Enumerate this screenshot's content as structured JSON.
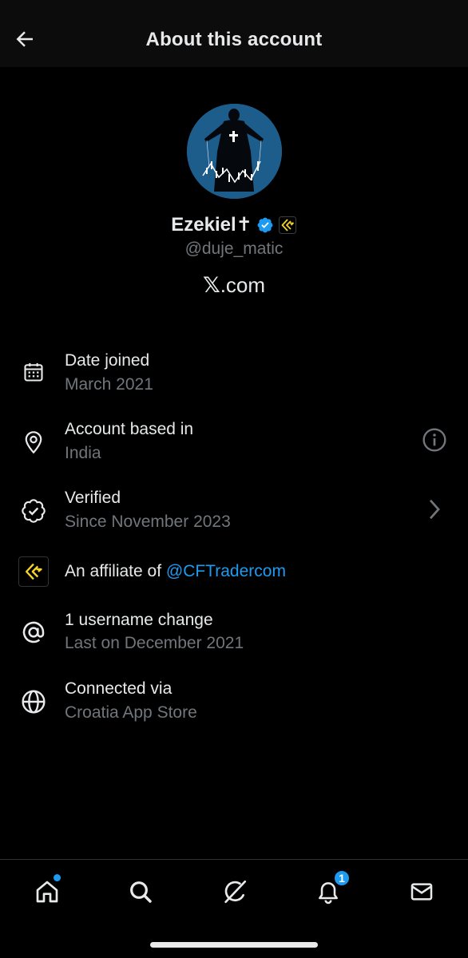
{
  "header": {
    "back_icon": "arrow-left-icon",
    "title": "About this account"
  },
  "profile": {
    "avatar_icon": "profile-avatar",
    "display_name": "Ezekiel✝",
    "verified_icon": "verified-badge-icon",
    "affiliate_badge_icon": "cftrader-affiliate-badge-icon",
    "handle": "@duje_matic",
    "x_letter": "𝕏",
    "domain_suffix": ".com"
  },
  "details": [
    {
      "icon": "calendar-icon",
      "title": "Date joined",
      "subtitle": "March 2021"
    },
    {
      "icon": "location-pin-icon",
      "title": "Account based in",
      "subtitle": "India",
      "right_icon": "info-icon"
    },
    {
      "icon": "verified-check-icon",
      "title": "Verified",
      "subtitle": "Since November 2023",
      "right_icon": "chevron-right-icon"
    },
    {
      "icon": "cftrader-logo-icon",
      "title_prefix": "An affiliate of ",
      "title_link": "@CFTradercom"
    },
    {
      "icon": "at-sign-icon",
      "title": "1 username change",
      "subtitle": "Last on December 2021"
    },
    {
      "icon": "globe-icon",
      "title": "Connected via",
      "subtitle": "Croatia App Store"
    }
  ],
  "tabbar": {
    "items": [
      {
        "icon": "home-icon",
        "has_dot": true
      },
      {
        "icon": "search-icon"
      },
      {
        "icon": "grok-icon"
      },
      {
        "icon": "bell-icon",
        "badge": "1"
      },
      {
        "icon": "mail-icon"
      }
    ]
  },
  "colors": {
    "background": "#000000",
    "header_bg": "#0c0c0d",
    "primary_text": "#e7e9ea",
    "secondary_text": "#71767b",
    "accent": "#1d9bf0",
    "affiliate_yellow": "#f5d327",
    "avatar_bg": "#1c5d8c"
  }
}
